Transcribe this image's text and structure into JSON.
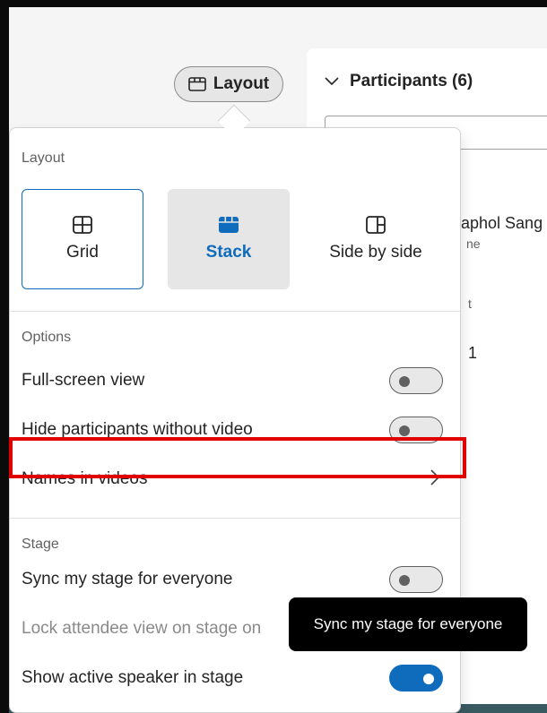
{
  "toolbar": {
    "layout_label": "Layout",
    "layout_icon": "layout-icon"
  },
  "participants": {
    "header": "Participants (6)",
    "chevron_icon": "chevron-down-icon",
    "visible_name_fragment": "aphol Sang",
    "visible_sub_fragment": "ne",
    "visible_section_fragment": "t",
    "visible_count_fragment": "1"
  },
  "flyout": {
    "layout_section": "Layout",
    "layout_options": [
      {
        "label": "Grid",
        "icon": "grid-icon",
        "selected": false
      },
      {
        "label": "Stack",
        "icon": "stack-icon",
        "selected": true
      },
      {
        "label": "Side by side",
        "icon": "side-by-side-icon",
        "selected": false
      }
    ],
    "options_section": "Options",
    "options": {
      "full_screen": {
        "label": "Full-screen view",
        "on": false
      },
      "hide_no_video": {
        "label": "Hide participants without video",
        "on": false
      },
      "names_in_videos": {
        "label": "Names in videos"
      }
    },
    "stage_section": "Stage",
    "stage": {
      "sync_stage": {
        "label": "Sync my stage for everyone",
        "on": false
      },
      "lock_attendee": {
        "label": "Lock attendee view on stage on"
      },
      "active_speaker": {
        "label": "Show active speaker in stage",
        "on": true
      }
    }
  },
  "tooltip": {
    "text": "Sync my stage for everyone"
  },
  "colors": {
    "accent": "#0f6cbd",
    "highlight": "#e00000",
    "tooltip_bg": "#000000"
  }
}
